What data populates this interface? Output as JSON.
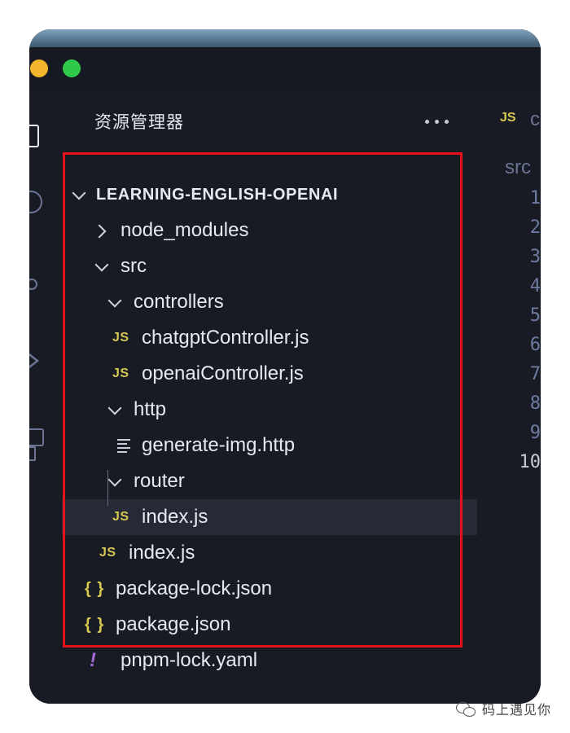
{
  "explorer": {
    "title": "资源管理器",
    "more_label": "···"
  },
  "tree": [
    {
      "label": "LEARNING-ENGLISH-OPENAI",
      "type": "root",
      "expanded": true
    },
    {
      "label": "node_modules",
      "type": "folder",
      "expanded": false
    },
    {
      "label": "src",
      "type": "folder",
      "expanded": true
    },
    {
      "label": "controllers",
      "type": "folder",
      "expanded": true
    },
    {
      "label": "chatgptController.js",
      "type": "file",
      "icon": "JS"
    },
    {
      "label": "openaiController.js",
      "type": "file",
      "icon": "JS"
    },
    {
      "label": "http",
      "type": "folder",
      "expanded": true
    },
    {
      "label": "generate-img.http",
      "type": "file",
      "icon": "lines"
    },
    {
      "label": "router",
      "type": "folder",
      "expanded": true
    },
    {
      "label": "index.js",
      "type": "file",
      "icon": "JS",
      "selected": true
    },
    {
      "label": "index.js",
      "type": "file",
      "icon": "JS"
    },
    {
      "label": "package-lock.json",
      "type": "file",
      "icon": "{ }"
    },
    {
      "label": "package.json",
      "type": "file",
      "icon": "{ }"
    },
    {
      "label": "pnpm-lock.yaml",
      "type": "file",
      "icon": "!"
    }
  ],
  "editor": {
    "tab_icon": "JS",
    "tab_name": "c",
    "breadcrumb": "src",
    "line_numbers": [
      "1",
      "2",
      "3",
      "4",
      "5",
      "6",
      "7",
      "8",
      "9",
      "10"
    ]
  },
  "watermark": {
    "text": "码上遇见你"
  },
  "colors": {
    "background": "#181b24",
    "js_icon": "#d6c850",
    "yaml_icon": "#a46ad8",
    "highlight_box": "#e8101a",
    "selected_row": "#262a37"
  }
}
